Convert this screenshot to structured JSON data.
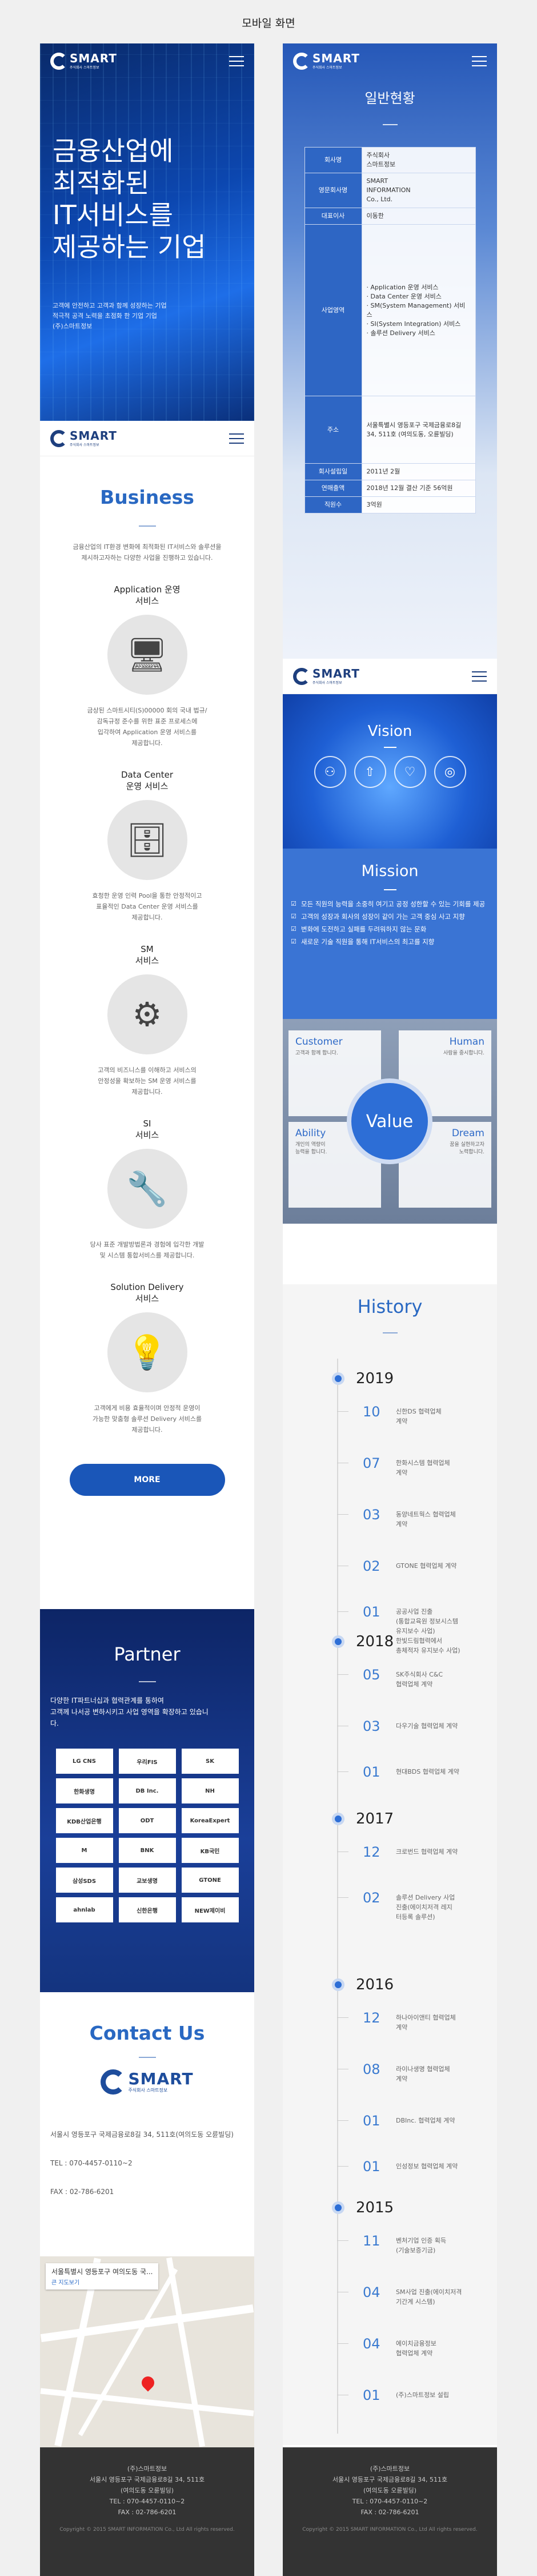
{
  "page_title": "모바일 화면",
  "brand": {
    "name": "SMART",
    "sub": "주식회사 스마트정보"
  },
  "hero": {
    "title": "금융산업에\n최적화된\nIT서비스를\n제공하는 기업",
    "desc": "고객에 안전하고 고객과 함께 성장하는 기업\n적극적 공격 노력을 초점화 한 기업 기업\n(주)스마트정보"
  },
  "business": {
    "title": "Business",
    "intro": "금융산업의 IT환경 변화에 최적화된 IT서비스와 솔루션을\n제시하고자하는 다양한 사업을 진행하고 있습니다.",
    "items": [
      {
        "title": "Application 운영\n서비스",
        "icon": "monitor-icon",
        "desc": "금상된 스마트시티(S)00000 회의 국내 법규/\n감독규정 준수를 위한 표준 프로세스에\n입각하여 Application 운영 서비스를\n제공합니다."
      },
      {
        "title": "Data Center\n운영 서비스",
        "icon": "server-icon",
        "desc": "효청한 운영 인력 Pool을 통한 안정적이고\n표율적인 Data Center 운영 서비스를\n제공합니다."
      },
      {
        "title": "SM\n서비스",
        "icon": "gear-screen-icon",
        "desc": "고객의 비즈니스를 이해하고 서비스의\n안정성을 확보하는 SM 운영 서비스를\n제공합니다."
      },
      {
        "title": "SI\n서비스",
        "icon": "tools-icon",
        "desc": "당사 표준 개발방법론과 경험에 입각한 개발\n및 시스템 통합서비스를 제공합니다."
      },
      {
        "title": "Solution Delivery\n서비스",
        "icon": "lightbulb-icon",
        "desc": "고객에게 비용 효율적이며 안정적 운영이\n가능한 맞춤형 솔루션 Delivery 서비스를\n제공합니다."
      }
    ],
    "more_label": "MORE"
  },
  "partner": {
    "title": "Partner",
    "desc": "다양한 IT파트너십과 협력관계를 통하여\n고객께 나서공 변하시키고 사업 영역을 확장하고 있습니\n다.",
    "logos": [
      "LG CNS",
      "우리FIS",
      "SK",
      "한화생명",
      "DB Inc.",
      "NH",
      "KDB산업은행",
      "ODT",
      "KoreaExpert",
      "M",
      "BNK",
      "KB국민",
      "삼성SDS",
      "교보생명",
      "GTONE",
      "ahnlab",
      "신한은행",
      "NEW제이비"
    ]
  },
  "contact": {
    "title": "Contact Us",
    "address": "서울시 영등포구 국제금융로8길 34, 511호(여의도동 오륜빌딩)",
    "tel": "TEL : 070-4457-0110~2",
    "fax": "FAX : 02-786-6201",
    "map_label": "서울특별시 영등포구 여의도동 국...",
    "map_link": "큰 지도보기"
  },
  "footer": {
    "company": "(주)스마트정보",
    "address": "서울시 영등포구 국제금융로8길 34, 511호\n(여의도동 오륜빌딩)",
    "tel": "TEL : 070-4457-0110~2",
    "fax": "FAX : 02-786-6201",
    "copyright": "Copyright © 2015 SMART INFORMATION Co., Ltd All rights reserved."
  },
  "overview": {
    "title": "일반현황",
    "rows": [
      {
        "k": "회사명",
        "v": "주식회사\n스마트정보"
      },
      {
        "k": "영문회사명",
        "v": "SMART\nINFORMATION\nCo., Ltd."
      },
      {
        "k": "대표이사",
        "v": "이동한"
      },
      {
        "k": "사업영역",
        "list": [
          "Application 운영 서비스",
          "Data Center 운영 서비스",
          "SM(System Management) 서비스",
          "SI(System Integration) 서비스",
          "솔루션 Delivery 서비스"
        ]
      },
      {
        "k": "주소",
        "v": "서울특별시 영등포구 국제금융로8길 34, 511호 (여의도동, 오륜빌딩)"
      },
      {
        "k": "회사설립일",
        "v": "2011년 2월"
      },
      {
        "k": "연매출액",
        "v": "2018년 12월 결산 기준 56억원"
      },
      {
        "k": "직원수",
        "v": "3억원"
      }
    ]
  },
  "vision": {
    "title": "Vision"
  },
  "mission": {
    "title": "Mission",
    "items": [
      "모든 직원의 능력을 소중히 여기고 공정 성한할 수 있는 기회를 제공",
      "고객의 성장과 회사의 성장이 같이 가는 고객 중심 사고 지향",
      "변화에 도전하고 실패를 두려워하지 않는 문화",
      "새로운 기술 직원을 통해 IT서비스의 최고를 지향"
    ]
  },
  "values": {
    "center": "Value",
    "boxes": [
      {
        "title": "Customer",
        "desc": "고객과 함께 합니다."
      },
      {
        "title": "Human",
        "desc": "사람을 중시합니다."
      },
      {
        "title": "Ability",
        "desc": "개인의 역량이\n능력을 합니다."
      },
      {
        "title": "Dream",
        "desc": "꿈을 실현하고자\n노력합니다."
      }
    ]
  },
  "history": {
    "title": "History",
    "years": [
      {
        "year": "2019",
        "events": [
          {
            "m": "10",
            "t": "신한DS 협력업체\n계약"
          },
          {
            "m": "07",
            "t": "한화시스템 협력업체\n계약"
          },
          {
            "m": "03",
            "t": "동양네트웍스 협력업체\n계약"
          },
          {
            "m": "02",
            "t": "GTONE 협력업체 계약"
          },
          {
            "m": "01",
            "t": "공공사업 진출\n(통합교육원 정보시스템\n유지보수 사업)\n한빛드림협력에서\n총체적자 유지보수 사업)"
          }
        ]
      },
      {
        "year": "2018",
        "events": [
          {
            "m": "05",
            "t": "SK주식회사 C&C\n협력업체 계약"
          },
          {
            "m": "03",
            "t": "다우기술 협력업체 계약"
          },
          {
            "m": "01",
            "t": "현대BDS 협력업체 계약"
          }
        ]
      },
      {
        "year": "2017",
        "events": [
          {
            "m": "12",
            "t": "크로번드 협력업체 계약"
          },
          {
            "m": "02",
            "t": "솔루션 Delivery 사업\n진출(에이치저격 레지\n터등록 솔루션)"
          }
        ]
      },
      {
        "year": "2016",
        "events": [
          {
            "m": "12",
            "t": "하나아이앤티 협력업체\n계약"
          },
          {
            "m": "08",
            "t": "라이나생명 협력업체\n계약"
          },
          {
            "m": "01",
            "t": "DBInc. 협력업체 계약"
          },
          {
            "m": "01",
            "t": "인성정보 협력업체 계약"
          }
        ]
      },
      {
        "year": "2015",
        "events": [
          {
            "m": "11",
            "t": "벤처기업 인증 획득\n(기술보증기금)"
          },
          {
            "m": "04",
            "t": "SM사업 진출(에이치저격\n기간계 시스템)"
          },
          {
            "m": "04",
            "t": "에이치금융정보\n협력업체 계약"
          },
          {
            "m": "01",
            "t": "(주)스마트정보 설립"
          }
        ]
      }
    ]
  }
}
